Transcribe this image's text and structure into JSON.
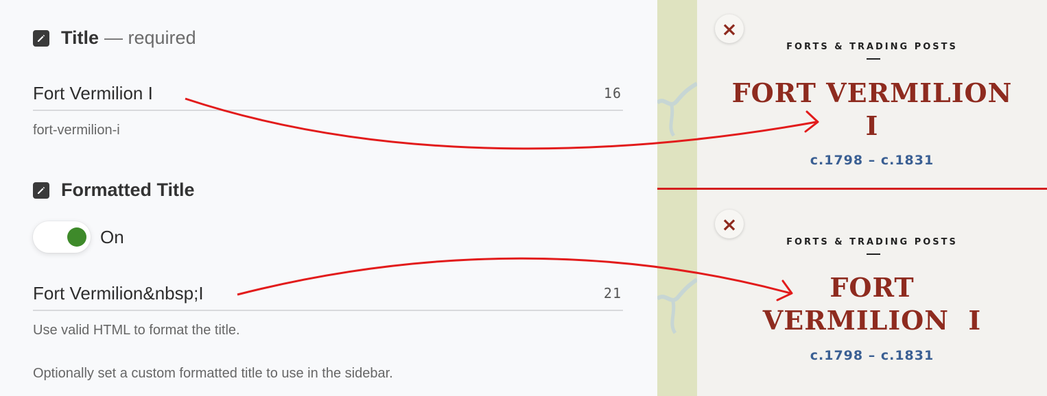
{
  "title_section": {
    "heading": "Title",
    "subheading": "— required",
    "value": "Fort Vermilion I",
    "count": "16",
    "slug": "fort-vermilion-i"
  },
  "formatted_section": {
    "heading": "Formatted Title",
    "toggle_label": "On",
    "toggle_state": "on",
    "value": "Fort Vermilion&nbsp;I",
    "count": "21",
    "hint": "Use valid HTML to format the title.",
    "note": "Optionally set a custom formatted title to use in the sidebar."
  },
  "preview_top": {
    "close": "×",
    "eyebrow": "FORTS & TRADING POSTS",
    "title_line1": "FORT VERMILION",
    "title_line2": "I",
    "dates": "c.1798 – c.1831"
  },
  "preview_bottom": {
    "close": "×",
    "eyebrow": "FORTS & TRADING POSTS",
    "title_line1": "FORT",
    "title_line2": "VERMILION  I",
    "dates": "c.1798 – c.1831"
  },
  "colors": {
    "accent_red": "#d41f1f",
    "title_red": "#8e2b1f",
    "date_blue": "#3a5f93",
    "toggle_green": "#3e8a2a"
  }
}
